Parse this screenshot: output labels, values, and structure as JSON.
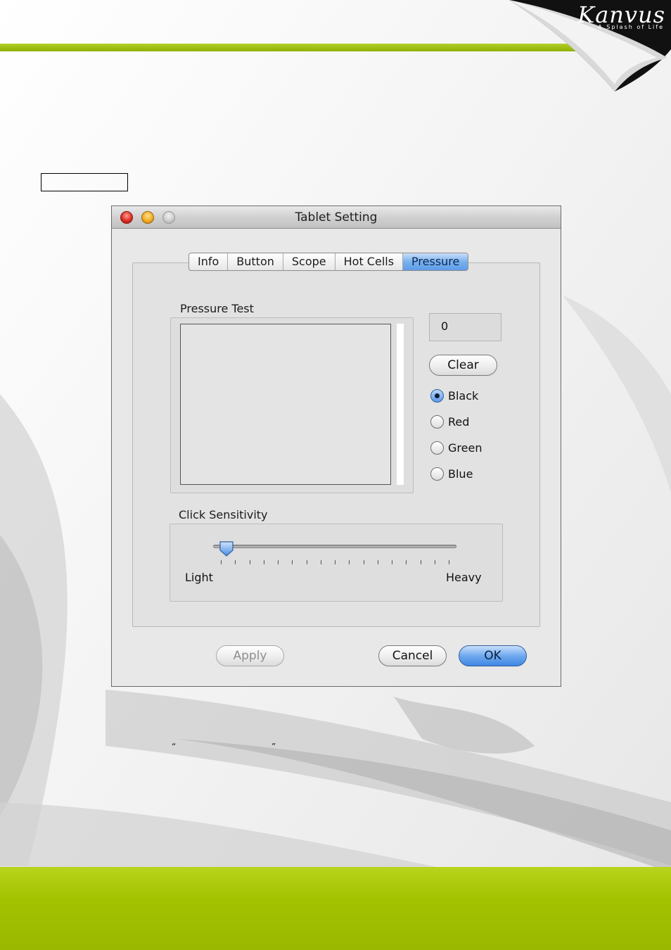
{
  "brand": {
    "name": "Kanvus",
    "tagline": "A Splash of Life"
  },
  "window": {
    "title": "Tablet Setting",
    "tabs": [
      {
        "label": "Info",
        "active": false
      },
      {
        "label": "Button",
        "active": false
      },
      {
        "label": "Scope",
        "active": false
      },
      {
        "label": "Hot Cells",
        "active": false
      },
      {
        "label": "Pressure",
        "active": true
      }
    ],
    "pressure_test": {
      "label": "Pressure Test",
      "value": "0",
      "clear_label": "Clear",
      "pen_colors": [
        {
          "label": "Black",
          "checked": true
        },
        {
          "label": "Red",
          "checked": false
        },
        {
          "label": "Green",
          "checked": false
        },
        {
          "label": "Blue",
          "checked": false
        }
      ]
    },
    "click_sensitivity": {
      "label": "Click Sensitivity",
      "min_label": "Light",
      "max_label": "Heavy",
      "level": 0.02,
      "tick_count": 17
    },
    "buttons": {
      "apply": "Apply",
      "cancel": "Cancel",
      "ok": "OK"
    }
  },
  "page_marks": {
    "quote_open": "“",
    "quote_close": "”"
  },
  "colors": {
    "accent_green": "#9ab800",
    "selection_blue": "#5d9ce8"
  }
}
